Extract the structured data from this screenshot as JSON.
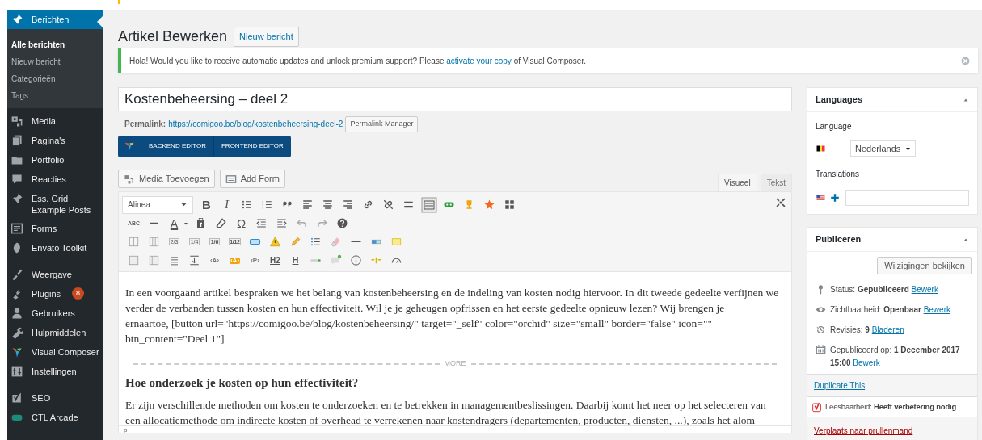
{
  "sidebar": {
    "groups": [
      [
        {
          "label": "Berichten",
          "selected": true,
          "children": [
            {
              "label": "Alle berichten",
              "selected": true
            },
            {
              "label": "Nieuw bericht",
              "selected": false
            },
            {
              "label": "Categorieën",
              "selected": false
            },
            {
              "label": "Tags",
              "selected": false
            }
          ]
        },
        {
          "label": "Media",
          "selected": false
        },
        {
          "label": "Pagina's",
          "selected": false
        },
        {
          "label": "Portfolio",
          "selected": false
        },
        {
          "label": "Reacties",
          "selected": false
        },
        {
          "label": "Ess. Grid Example Posts",
          "selected": false
        },
        {
          "label": "Forms",
          "selected": false
        },
        {
          "label": "Envato Toolkit",
          "selected": false
        }
      ],
      [
        {
          "label": "Weergave",
          "selected": false
        },
        {
          "label": "Plugins",
          "selected": false,
          "badge": "8"
        },
        {
          "label": "Gebruikers",
          "selected": false
        },
        {
          "label": "Hulpmiddelen",
          "selected": false
        },
        {
          "label": "Visual Composer",
          "selected": false
        },
        {
          "label": "Instellingen",
          "selected": false
        }
      ],
      [
        {
          "label": "SEO",
          "selected": false
        },
        {
          "label": "CTL Arcade",
          "selected": false
        }
      ]
    ]
  },
  "page_title": "Artikel Bewerken",
  "new_post_button": "Nieuw bericht",
  "notice": {
    "text_before": "Hola! Would you like to receive automatic updates and unlock premium support? Please ",
    "link": "activate your copy",
    "text_after": " of Visual Composer."
  },
  "post_title": "Kostenbeheersing – deel 2",
  "permalink": {
    "label": "Permalink:",
    "url": "https://comigoo.be/blog/kostenbeheersing-deel-2",
    "button": "Permalink Manager"
  },
  "composer_buttons": [
    "BACKEND EDITOR",
    "FRONTEND EDITOR"
  ],
  "media_buttons": [
    "Media Toevoegen",
    "Add Form"
  ],
  "editor_tabs": [
    {
      "label": "Visueel",
      "selected": true
    },
    {
      "label": "Tekst",
      "selected": false
    }
  ],
  "format_select": "Alinea",
  "toolbar_labels": [
    "B",
    "I",
    "ABC",
    "A",
    "Ω",
    "2/3",
    "1/4",
    "1/6",
    "1/12",
    "‹A›",
    "‹A›",
    "‹P›",
    "H2",
    "H"
  ],
  "content": [
    {
      "kind": "paragraph",
      "lines": [
        "In een voorgaand artikel bespraken we het belang van kostenbeheersing en de indeling van kosten nodig hiervoor. In dit tweede gedeelte verfijnen we",
        "verder de verbanden tussen kosten en hun effectiviteit. Wil je je geheugen opfrissen en het eerste gedeelte opnieuw lezen? Wij brengen je",
        "ernaartoe, [button url=\"https://comigoo.be/blog/kostenbeheersing/\" target=\"_self\" color=\"orchid\" size=\"small\" border=\"false\" icon=\"\"",
        "btn_content=\"Deel 1\"]"
      ]
    },
    {
      "kind": "more",
      "text": "MORE"
    },
    {
      "kind": "heading",
      "text": "Hoe onderzoek je kosten op hun effectiviteit?"
    },
    {
      "kind": "paragraph",
      "lines": [
        "Er zijn verschillende methoden om kosten te onderzoeken en te betrekken in managementbeslissingen. Daarbij komt het neer op het selecteren van",
        "een allocatiemethode om indirecte kosten of overhead te verrekenen naar kostendragers (departementen, producten, diensten, ...), zoals het alom"
      ]
    }
  ],
  "path_bar": "p",
  "languages": {
    "title": "Languages",
    "language_label": "Language",
    "language": "Nederlands",
    "translations_label": "Translations"
  },
  "publish": {
    "title": "Publiceren",
    "preview_button": "Wijzigingen bekijken",
    "rows": [
      {
        "kind": "status",
        "text": "Status: **Gepubliceerd**",
        "link": "Bewerk"
      },
      {
        "kind": "visibility",
        "text": "Zichtbaarheid: **Openbaar**",
        "link": "Bewerk"
      },
      {
        "kind": "revisions",
        "text": "Revisies: **9**",
        "link": "Bladeren"
      },
      {
        "kind": "date",
        "text": "Gepubliceerd op: **1 December 2017 15:00**",
        "link": "Bewerk"
      }
    ],
    "duplicate_link": "Duplicate This",
    "readability": "Leesbaarheid: **Heeft verbetering nodig**",
    "trash_link": "Verplaats naar prullenmand"
  }
}
